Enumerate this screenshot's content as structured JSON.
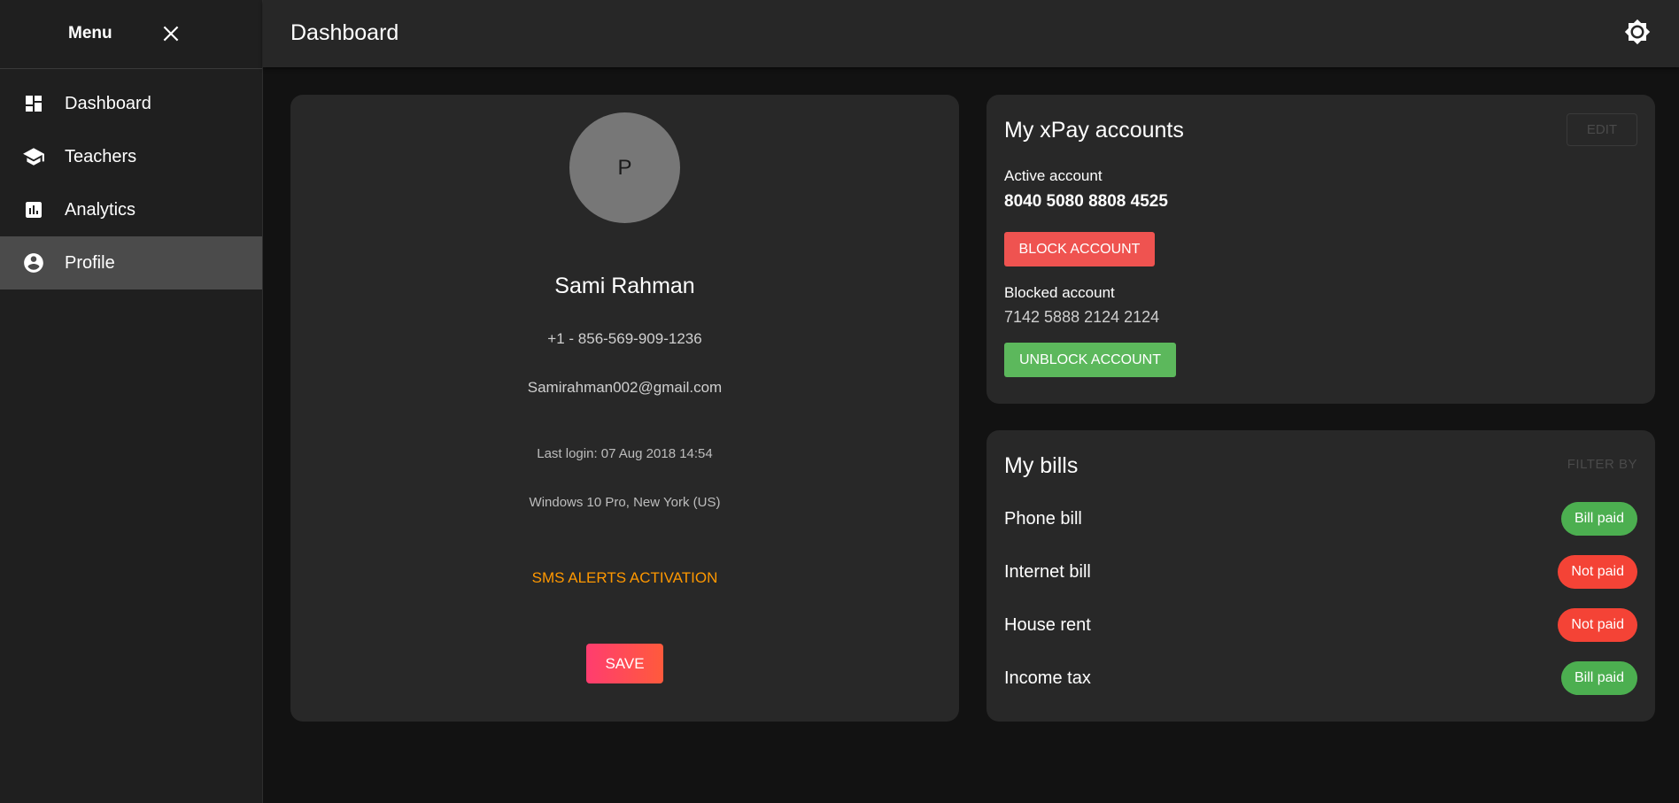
{
  "sidebar": {
    "title": "Menu",
    "items": [
      {
        "label": "Dashboard",
        "icon": "dashboard-icon",
        "active": false
      },
      {
        "label": "Teachers",
        "icon": "school-icon",
        "active": false
      },
      {
        "label": "Analytics",
        "icon": "analytics-icon",
        "active": false
      },
      {
        "label": "Profile",
        "icon": "account-circle-icon",
        "active": true
      }
    ]
  },
  "header": {
    "title": "Dashboard",
    "theme_icon": "brightness-icon"
  },
  "profile": {
    "avatar_initial": "P",
    "name": "Sami Rahman",
    "phone": "+1 - 856-569-909-1236",
    "email": "Samirahman002@gmail.com",
    "last_login": "Last login: 07 Aug 2018 14:54",
    "device": "Windows 10 Pro, New York (US)",
    "sms_link": "SMS ALERTS ACTIVATION",
    "save_label": "SAVE"
  },
  "xpay": {
    "title": "My xPay accounts",
    "edit_label": "EDIT",
    "active_label": "Active account",
    "active_number": "8040 5080 8808 4525",
    "block_label": "BLOCK ACCOUNT",
    "blocked_label": "Blocked account",
    "blocked_number": "7142 5888 2124 2124",
    "unblock_label": "UNBLOCK ACCOUNT"
  },
  "bills": {
    "title": "My bills",
    "filter_label": "FILTER BY",
    "items": [
      {
        "name": "Phone bill",
        "status": "Bill paid",
        "color": "#4caf50"
      },
      {
        "name": "Internet bill",
        "status": "Not paid",
        "color": "#f44336"
      },
      {
        "name": "House rent",
        "status": "Not paid",
        "color": "#f44336"
      },
      {
        "name": "Income tax",
        "status": "Bill paid",
        "color": "#4caf50"
      }
    ]
  },
  "colors": {
    "accent_orange": "#ff9800",
    "danger": "#ef5350",
    "success": "#5cb85c"
  }
}
